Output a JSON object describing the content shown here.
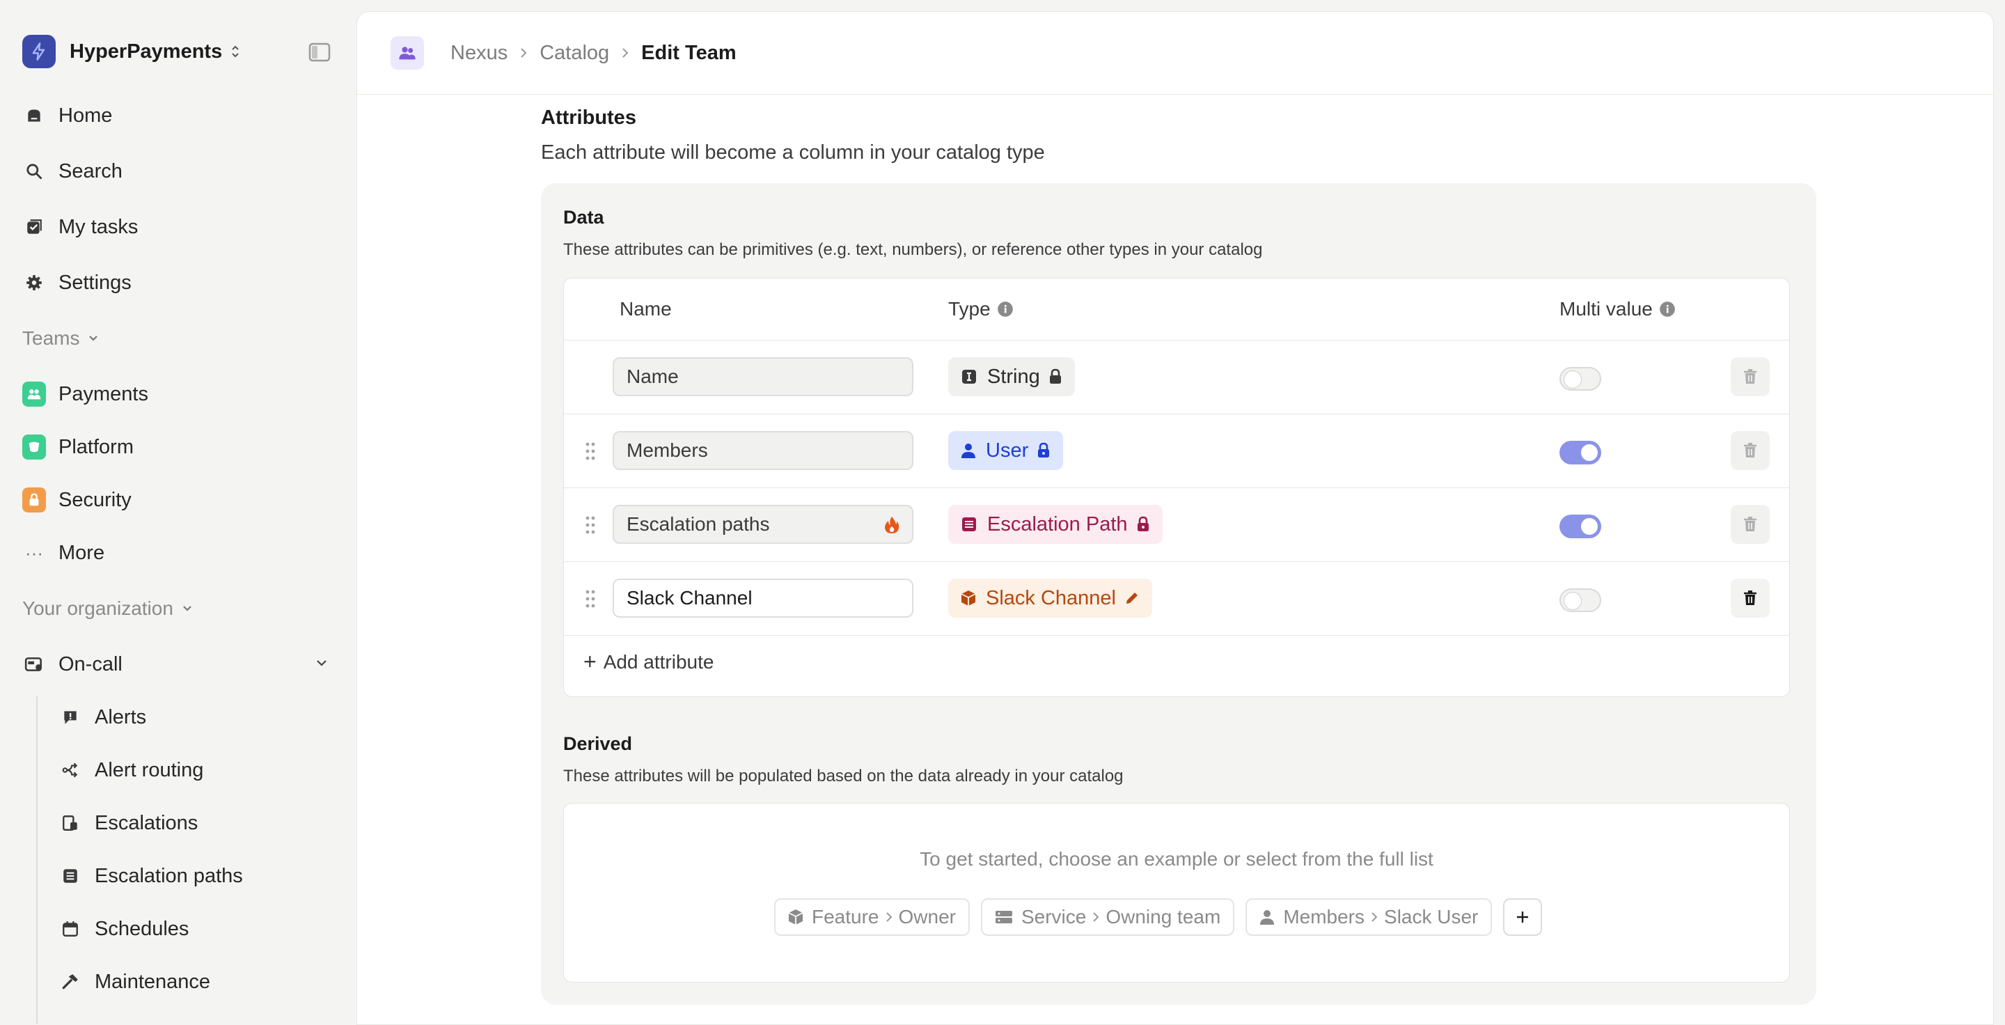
{
  "org": {
    "name": "HyperPayments"
  },
  "nav": {
    "home": "Home",
    "search": "Search",
    "my_tasks": "My tasks",
    "settings": "Settings"
  },
  "teams": {
    "header": "Teams",
    "items": [
      {
        "label": "Payments",
        "color": "#3ccf91"
      },
      {
        "label": "Platform",
        "color": "#3ccf91"
      },
      {
        "label": "Security",
        "color": "#f29c4a"
      }
    ],
    "more": "More"
  },
  "your_org": {
    "header": "Your organization"
  },
  "oncall": {
    "label": "On-call",
    "items": [
      "Alerts",
      "Alert routing",
      "Escalations",
      "Escalation paths",
      "Schedules",
      "Maintenance"
    ]
  },
  "breadcrumb": [
    "Nexus",
    "Catalog",
    "Edit Team"
  ],
  "attributes": {
    "title": "Attributes",
    "description": "Each attribute will become a column in your catalog type"
  },
  "data_section": {
    "title": "Data",
    "description": "These attributes can be primitives (e.g. text, numbers), or reference other types in your catalog",
    "columns": {
      "name": "Name",
      "type": "Type",
      "multi": "Multi value"
    },
    "rows": [
      {
        "name": "Name",
        "type": "String",
        "type_icon": "string-icon",
        "type_status": "lock-icon",
        "multi": false,
        "badge_bg": "#f0f0ef",
        "badge_fg": "#2b2b2b"
      },
      {
        "name": "Members",
        "type": "User",
        "type_icon": "user-icon",
        "type_status": "lock-icon",
        "multi": true,
        "badge_bg": "#dde6fd",
        "badge_fg": "#1d3fd6"
      },
      {
        "name": "Escalation paths",
        "type": "Escalation Path",
        "type_icon": "escalation-path-icon",
        "type_status": "lock-icon",
        "multi": true,
        "badge_bg": "#fcebf1",
        "badge_fg": "#9c1b4b"
      },
      {
        "name": "Slack Channel",
        "type": "Slack Channel",
        "type_icon": "cube-icon",
        "type_status": "pencil-icon",
        "multi": false,
        "badge_bg": "#fdf0e4",
        "badge_fg": "#b5480e"
      }
    ],
    "add_label": "Add attribute"
  },
  "derived_section": {
    "title": "Derived",
    "description": "These attributes will be populated based on the data already in your catalog",
    "hint": "To get started, choose an example or select from the full list",
    "examples": [
      {
        "from": "Feature",
        "to": "Owner",
        "icon": "cube-icon"
      },
      {
        "from": "Service",
        "to": "Owning team",
        "icon": "server-icon"
      },
      {
        "from": "Members",
        "to": "Slack User",
        "icon": "user-icon"
      }
    ]
  }
}
